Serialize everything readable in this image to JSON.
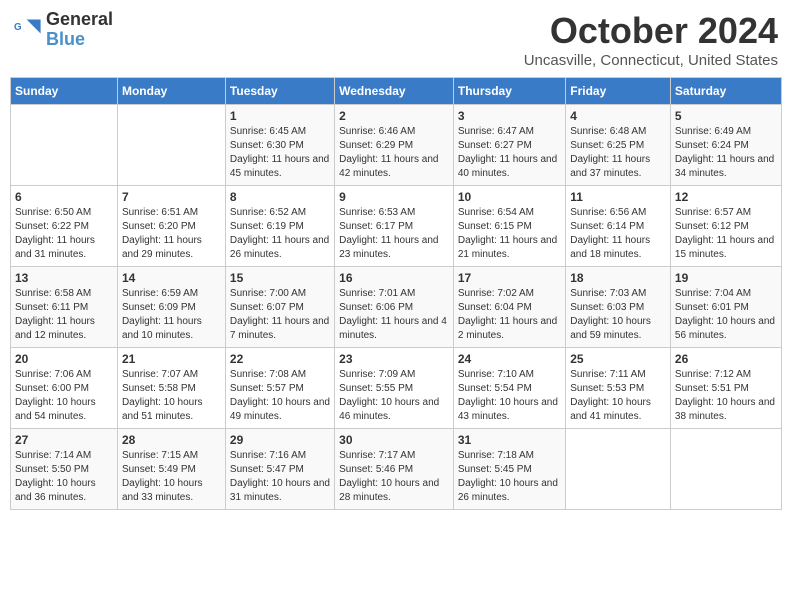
{
  "header": {
    "logo_line1": "General",
    "logo_line2": "Blue",
    "main_title": "October 2024",
    "subtitle": "Uncasville, Connecticut, United States"
  },
  "days_of_week": [
    "Sunday",
    "Monday",
    "Tuesday",
    "Wednesday",
    "Thursday",
    "Friday",
    "Saturday"
  ],
  "weeks": [
    [
      {
        "day": "",
        "info": ""
      },
      {
        "day": "",
        "info": ""
      },
      {
        "day": "1",
        "info": "Sunrise: 6:45 AM\nSunset: 6:30 PM\nDaylight: 11 hours and 45 minutes."
      },
      {
        "day": "2",
        "info": "Sunrise: 6:46 AM\nSunset: 6:29 PM\nDaylight: 11 hours and 42 minutes."
      },
      {
        "day": "3",
        "info": "Sunrise: 6:47 AM\nSunset: 6:27 PM\nDaylight: 11 hours and 40 minutes."
      },
      {
        "day": "4",
        "info": "Sunrise: 6:48 AM\nSunset: 6:25 PM\nDaylight: 11 hours and 37 minutes."
      },
      {
        "day": "5",
        "info": "Sunrise: 6:49 AM\nSunset: 6:24 PM\nDaylight: 11 hours and 34 minutes."
      }
    ],
    [
      {
        "day": "6",
        "info": "Sunrise: 6:50 AM\nSunset: 6:22 PM\nDaylight: 11 hours and 31 minutes."
      },
      {
        "day": "7",
        "info": "Sunrise: 6:51 AM\nSunset: 6:20 PM\nDaylight: 11 hours and 29 minutes."
      },
      {
        "day": "8",
        "info": "Sunrise: 6:52 AM\nSunset: 6:19 PM\nDaylight: 11 hours and 26 minutes."
      },
      {
        "day": "9",
        "info": "Sunrise: 6:53 AM\nSunset: 6:17 PM\nDaylight: 11 hours and 23 minutes."
      },
      {
        "day": "10",
        "info": "Sunrise: 6:54 AM\nSunset: 6:15 PM\nDaylight: 11 hours and 21 minutes."
      },
      {
        "day": "11",
        "info": "Sunrise: 6:56 AM\nSunset: 6:14 PM\nDaylight: 11 hours and 18 minutes."
      },
      {
        "day": "12",
        "info": "Sunrise: 6:57 AM\nSunset: 6:12 PM\nDaylight: 11 hours and 15 minutes."
      }
    ],
    [
      {
        "day": "13",
        "info": "Sunrise: 6:58 AM\nSunset: 6:11 PM\nDaylight: 11 hours and 12 minutes."
      },
      {
        "day": "14",
        "info": "Sunrise: 6:59 AM\nSunset: 6:09 PM\nDaylight: 11 hours and 10 minutes."
      },
      {
        "day": "15",
        "info": "Sunrise: 7:00 AM\nSunset: 6:07 PM\nDaylight: 11 hours and 7 minutes."
      },
      {
        "day": "16",
        "info": "Sunrise: 7:01 AM\nSunset: 6:06 PM\nDaylight: 11 hours and 4 minutes."
      },
      {
        "day": "17",
        "info": "Sunrise: 7:02 AM\nSunset: 6:04 PM\nDaylight: 11 hours and 2 minutes."
      },
      {
        "day": "18",
        "info": "Sunrise: 7:03 AM\nSunset: 6:03 PM\nDaylight: 10 hours and 59 minutes."
      },
      {
        "day": "19",
        "info": "Sunrise: 7:04 AM\nSunset: 6:01 PM\nDaylight: 10 hours and 56 minutes."
      }
    ],
    [
      {
        "day": "20",
        "info": "Sunrise: 7:06 AM\nSunset: 6:00 PM\nDaylight: 10 hours and 54 minutes."
      },
      {
        "day": "21",
        "info": "Sunrise: 7:07 AM\nSunset: 5:58 PM\nDaylight: 10 hours and 51 minutes."
      },
      {
        "day": "22",
        "info": "Sunrise: 7:08 AM\nSunset: 5:57 PM\nDaylight: 10 hours and 49 minutes."
      },
      {
        "day": "23",
        "info": "Sunrise: 7:09 AM\nSunset: 5:55 PM\nDaylight: 10 hours and 46 minutes."
      },
      {
        "day": "24",
        "info": "Sunrise: 7:10 AM\nSunset: 5:54 PM\nDaylight: 10 hours and 43 minutes."
      },
      {
        "day": "25",
        "info": "Sunrise: 7:11 AM\nSunset: 5:53 PM\nDaylight: 10 hours and 41 minutes."
      },
      {
        "day": "26",
        "info": "Sunrise: 7:12 AM\nSunset: 5:51 PM\nDaylight: 10 hours and 38 minutes."
      }
    ],
    [
      {
        "day": "27",
        "info": "Sunrise: 7:14 AM\nSunset: 5:50 PM\nDaylight: 10 hours and 36 minutes."
      },
      {
        "day": "28",
        "info": "Sunrise: 7:15 AM\nSunset: 5:49 PM\nDaylight: 10 hours and 33 minutes."
      },
      {
        "day": "29",
        "info": "Sunrise: 7:16 AM\nSunset: 5:47 PM\nDaylight: 10 hours and 31 minutes."
      },
      {
        "day": "30",
        "info": "Sunrise: 7:17 AM\nSunset: 5:46 PM\nDaylight: 10 hours and 28 minutes."
      },
      {
        "day": "31",
        "info": "Sunrise: 7:18 AM\nSunset: 5:45 PM\nDaylight: 10 hours and 26 minutes."
      },
      {
        "day": "",
        "info": ""
      },
      {
        "day": "",
        "info": ""
      }
    ]
  ]
}
